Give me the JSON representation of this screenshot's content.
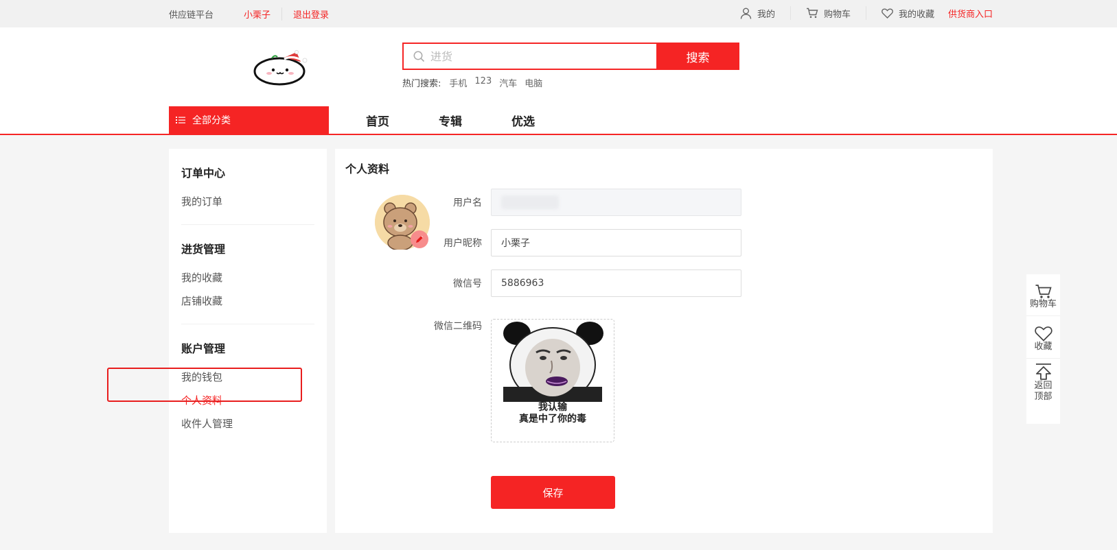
{
  "topbar": {
    "platform": "供应链平台",
    "username": "小栗子",
    "logout": "退出登录",
    "mine": "我的",
    "cart": "购物车",
    "favorites": "我的收藏",
    "supplier_entry": "供货商入口"
  },
  "search": {
    "placeholder": "进货",
    "button": "搜索",
    "hot_label": "热门搜索:",
    "hot_items": [
      "手机",
      "123",
      "汽车",
      "电脑"
    ]
  },
  "nav": {
    "all_categories": "全部分类",
    "items": [
      "首页",
      "专辑",
      "优选"
    ]
  },
  "sidebar": {
    "groups": [
      {
        "title": "订单中心",
        "items": [
          "我的订单"
        ]
      },
      {
        "title": "进货管理",
        "items": [
          "我的收藏",
          "店铺收藏"
        ]
      },
      {
        "title": "账户管理",
        "items": [
          "我的钱包",
          "个人资料",
          "收件人管理"
        ]
      }
    ],
    "active_item": "个人资料"
  },
  "profile": {
    "title": "个人资料",
    "username_label": "用户名",
    "nickname_label": "用户昵称",
    "nickname_value": "小栗子",
    "wechat_label": "微信号",
    "wechat_value": "5886963",
    "qr_label": "微信二维码",
    "qr_caption_line1": "我认输",
    "qr_caption_line2": "真是中了你的毒",
    "save_button": "保存"
  },
  "float_toolbar": {
    "cart": "购物车",
    "favorite": "收藏",
    "back_top_line1": "返回",
    "back_top_line2": "顶部"
  },
  "colors": {
    "accent": "#f52424",
    "background": "#f5f5f5"
  }
}
